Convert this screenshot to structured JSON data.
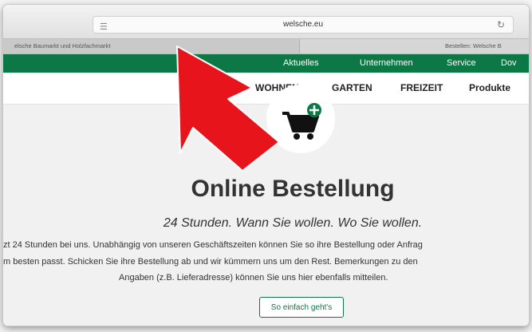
{
  "browser": {
    "url": "welsche.eu",
    "active_tab": "elsche Baumarkt und Holzfachmarkt",
    "other_tab": "Bestellen: Welsche B"
  },
  "top_nav": [
    "Aktuelles",
    "Unternehmen",
    "Service",
    "Dov"
  ],
  "main_menu": [
    "WOHNEN",
    "GARTEN",
    "FREIZEIT",
    "Produkte"
  ],
  "page": {
    "title": "Online Bestellung",
    "subtitle": "24 Stunden. Wann Sie wollen. Wo Sie wollen.",
    "body_lines": [
      "zt 24 Stunden bei uns. Unabhängig von unseren Geschäftszeiten können Sie so ihre Bestellung oder Anfrag",
      "m besten passt. Schicken Sie ihre Bestellung ab und wir kümmern uns um den Rest. Bemerkungen zu den",
      "Angaben (z.B. Lieferadresse) können Sie uns hier ebenfalls mitteilen."
    ],
    "cta_label": "So einfach geht's"
  },
  "colors": {
    "brand_green": "#0b7846",
    "arrow_red": "#e8141b"
  },
  "icons": [
    "menu-lines-icon",
    "reload-icon",
    "cart-add-icon",
    "red-arrow-annotation"
  ]
}
